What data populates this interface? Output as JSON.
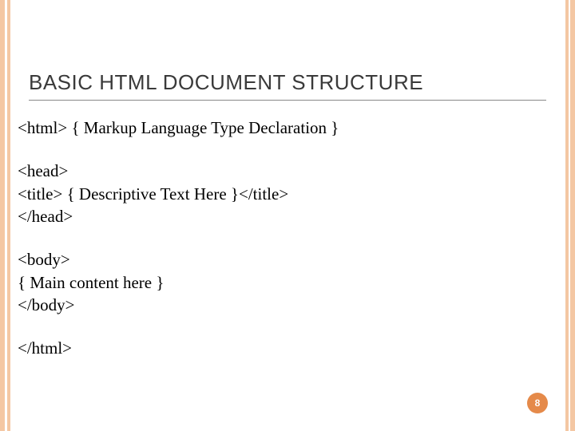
{
  "title": "BASIC HTML DOCUMENT STRUCTURE",
  "blocks": {
    "b0": {
      "l0": "<html> { Markup Language Type Declaration }"
    },
    "b1": {
      "l0": "<head>",
      "l1": "<title> { Descriptive Text Here }</title>",
      "l2": "</head>"
    },
    "b2": {
      "l0": "<body>",
      "l1": "{ Main content here }",
      "l2": "</body>"
    },
    "b3": {
      "l0": "</html>"
    }
  },
  "page_number": "8"
}
